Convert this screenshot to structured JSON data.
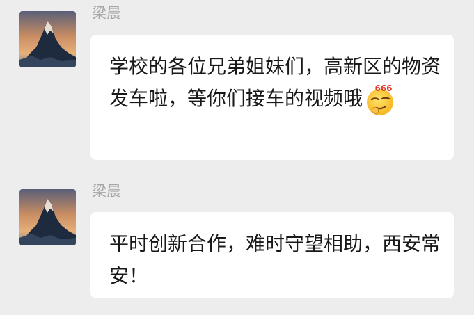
{
  "messages": [
    {
      "sender": "梁晨",
      "text": "学校的各位兄弟姐妹们，高新区的物资发车啦，等你们接车的视频哦",
      "emoji": "emoji-666-smirk-icon",
      "emoji_text": "666"
    },
    {
      "sender": "梁晨",
      "text": "平时创新合作，难时守望相助，西安常安！"
    }
  ],
  "colors": {
    "background": "#ededed",
    "bubble": "#ffffff",
    "sender_name": "#a6a6a6",
    "message_text": "#191919"
  }
}
